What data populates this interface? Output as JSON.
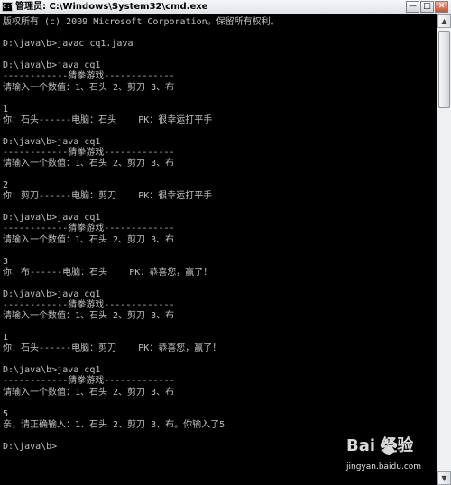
{
  "window": {
    "title": "管理员: C:\\Windows\\System32\\cmd.exe",
    "icon_text": "C:\\",
    "minimize_glyph": "—",
    "maximize_glyph": "□",
    "close_glyph": "✕"
  },
  "console": {
    "lines": [
      "版权所有 (c) 2009 Microsoft Corporation。保留所有权利。",
      "",
      "D:\\java\\b>javac cq1.java",
      "",
      "D:\\java\\b>java cq1",
      "------------猜拳游戏-------------",
      "请输入一个数值：1、石头 2、剪刀 3、布",
      "",
      "1",
      "你：石头------电脑：石头    PK：很幸运打平手",
      "",
      "D:\\java\\b>java cq1",
      "------------猜拳游戏-------------",
      "请输入一个数值：1、石头 2、剪刀 3、布",
      "",
      "2",
      "你：剪刀------电脑：剪刀    PK：很幸运打平手",
      "",
      "D:\\java\\b>java cq1",
      "------------猜拳游戏-------------",
      "请输入一个数值：1、石头 2、剪刀 3、布",
      "",
      "3",
      "你：布------电脑：石头    PK：恭喜您，赢了！",
      "",
      "D:\\java\\b>java cq1",
      "------------猜拳游戏-------------",
      "请输入一个数值：1、石头 2、剪刀 3、布",
      "",
      "1",
      "你：石头------电脑：剪刀    PK：恭喜您，赢了！",
      "",
      "D:\\java\\b>java cq1",
      "------------猜拳游戏-------------",
      "请输入一个数值：1、石头 2、剪刀 3、布",
      "",
      "5",
      "亲，请正确输入：1、石头 2、剪刀 3、布。你输入了5",
      "",
      "D:\\java\\b>"
    ]
  },
  "scrollbar": {
    "up_glyph": "▲",
    "down_glyph": "▼",
    "position": 0.0
  },
  "watermark": {
    "logo_text": "Bai  经验",
    "url": "jingyan.baidu.com"
  },
  "colors": {
    "console_bg": "#000000",
    "console_text": "#c0c0c0",
    "watermark": "#d8d8d8"
  },
  "icons": {
    "app": "cmd-icon",
    "paw": "baidu-paw-icon"
  }
}
